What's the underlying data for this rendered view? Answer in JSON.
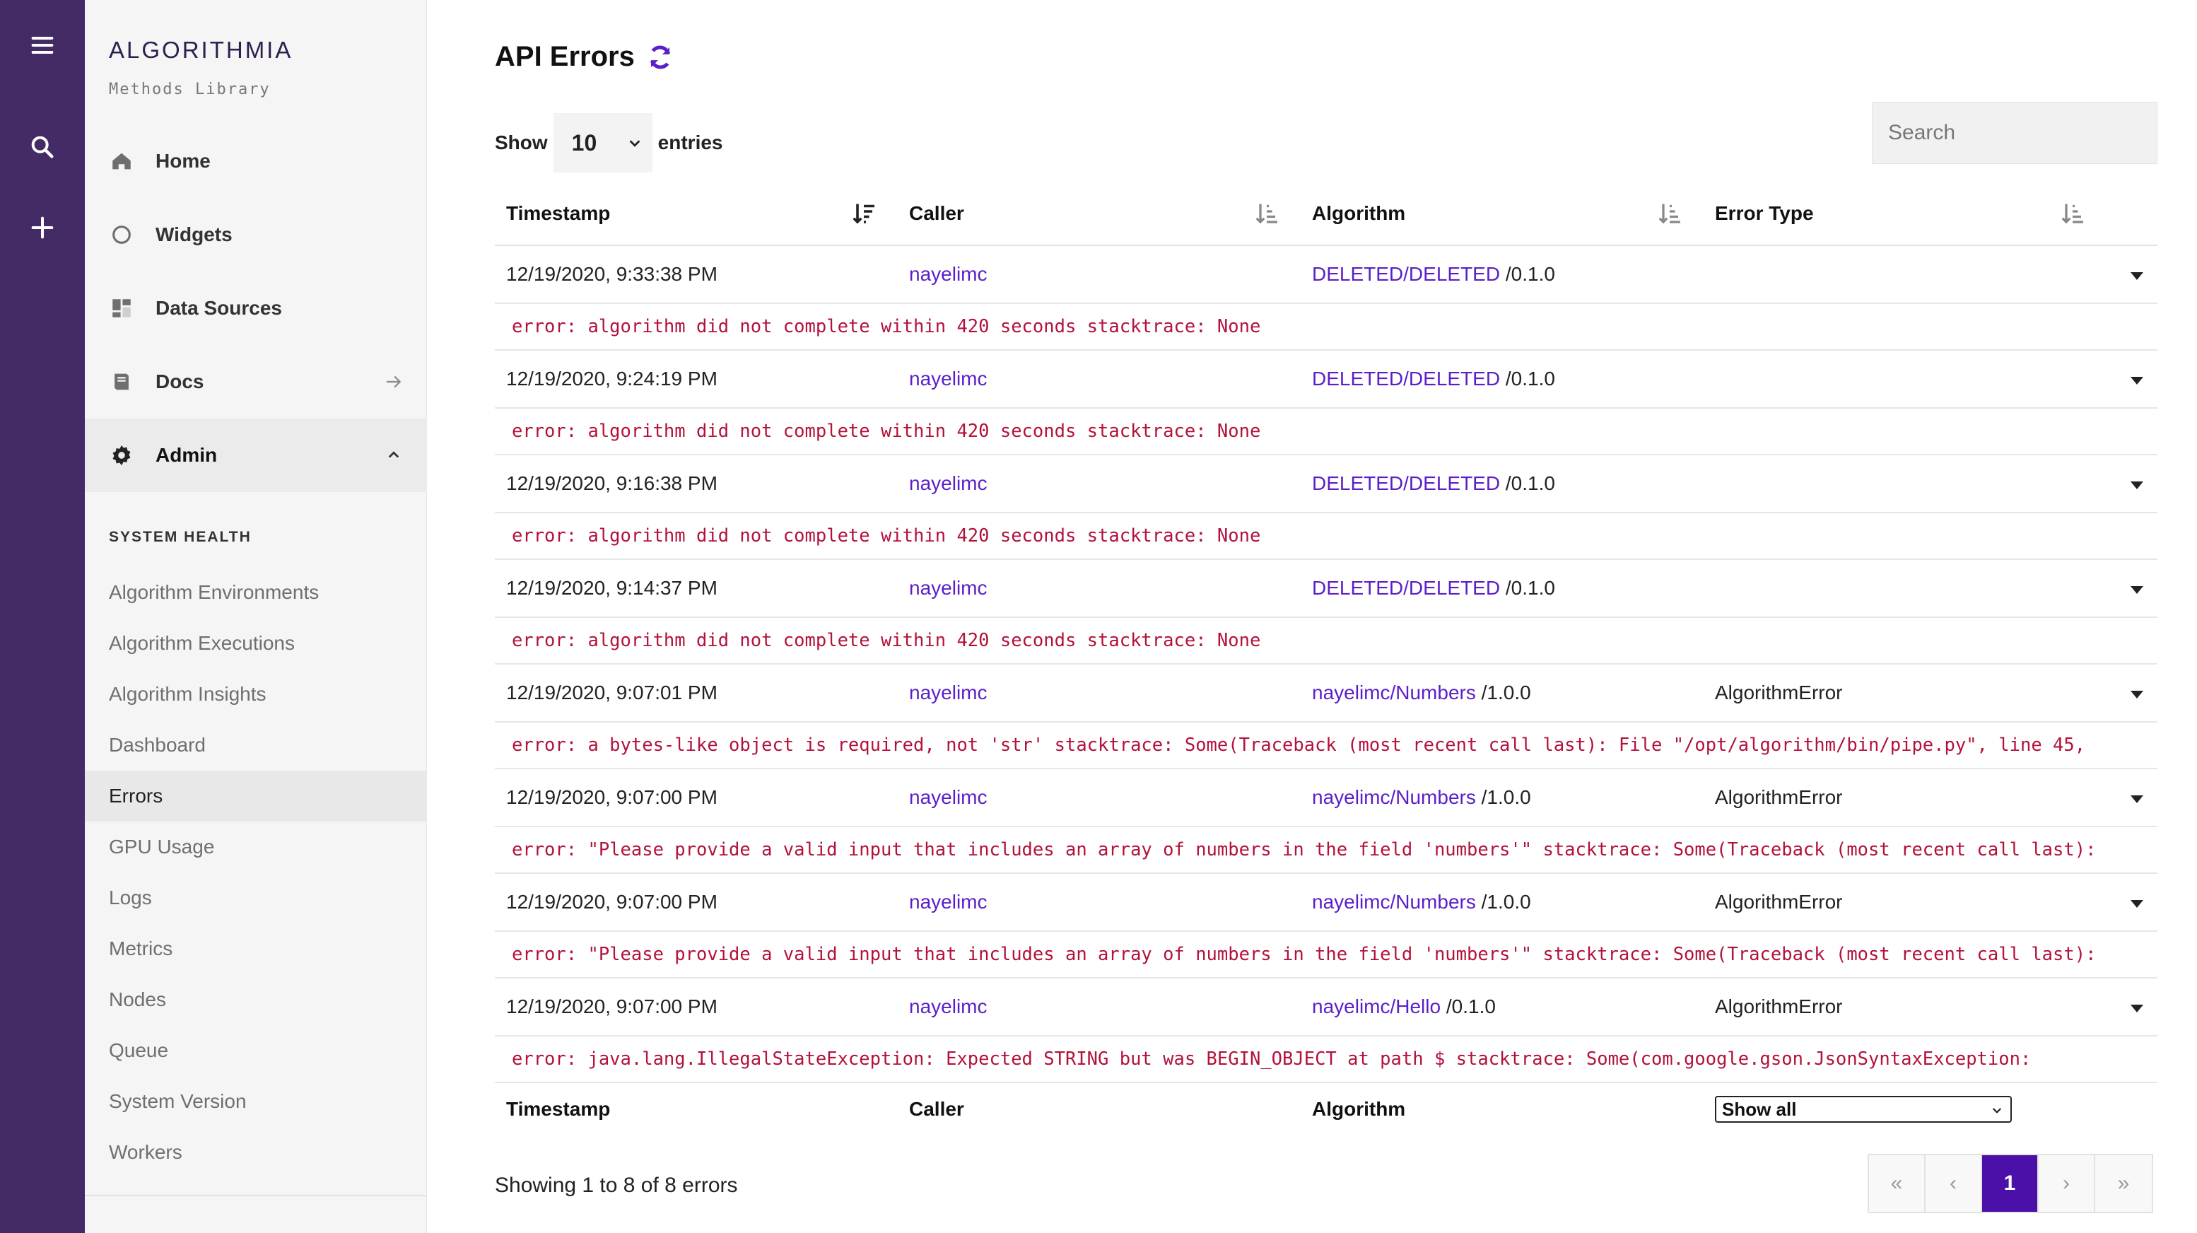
{
  "brand": {
    "name": "ALGORITHMIA",
    "subtitle": "Methods Library"
  },
  "nav": [
    {
      "label": "Home",
      "icon": "home-icon"
    },
    {
      "label": "Widgets",
      "icon": "circle-icon"
    },
    {
      "label": "Data Sources",
      "icon": "grid-icon"
    },
    {
      "label": "Docs",
      "icon": "book-icon"
    },
    {
      "label": "Admin",
      "icon": "gear-icon"
    }
  ],
  "admin_section": {
    "heading": "SYSTEM HEALTH",
    "items": [
      "Algorithm Environments",
      "Algorithm Executions",
      "Algorithm Insights",
      "Dashboard",
      "Errors",
      "GPU Usage",
      "Logs",
      "Metrics",
      "Nodes",
      "Queue",
      "System Version",
      "Workers"
    ],
    "selected": "Errors"
  },
  "page": {
    "title": "API Errors"
  },
  "controls": {
    "show_label": "Show",
    "entries_value": "10",
    "entries_label": "entries",
    "search_placeholder": "Search"
  },
  "table": {
    "columns": [
      "Timestamp",
      "Caller",
      "Algorithm",
      "Error Type"
    ],
    "footer_columns": [
      "Timestamp",
      "Caller",
      "Algorithm"
    ],
    "error_type_filter": "Show all",
    "rows": [
      {
        "timestamp": "12/19/2020, 9:33:38 PM",
        "caller": "nayelimc",
        "algorithm": "DELETED/DELETED",
        "version": "/0.1.0",
        "error_type": "",
        "message": "error: algorithm did not complete within 420 seconds stacktrace: None"
      },
      {
        "timestamp": "12/19/2020, 9:24:19 PM",
        "caller": "nayelimc",
        "algorithm": "DELETED/DELETED",
        "version": "/0.1.0",
        "error_type": "",
        "message": "error: algorithm did not complete within 420 seconds stacktrace: None"
      },
      {
        "timestamp": "12/19/2020, 9:16:38 PM",
        "caller": "nayelimc",
        "algorithm": "DELETED/DELETED",
        "version": "/0.1.0",
        "error_type": "",
        "message": "error: algorithm did not complete within 420 seconds stacktrace: None"
      },
      {
        "timestamp": "12/19/2020, 9:14:37 PM",
        "caller": "nayelimc",
        "algorithm": "DELETED/DELETED",
        "version": "/0.1.0",
        "error_type": "",
        "message": "error: algorithm did not complete within 420 seconds stacktrace: None"
      },
      {
        "timestamp": "12/19/2020, 9:07:01 PM",
        "caller": "nayelimc",
        "algorithm": "nayelimc/Numbers",
        "version": "/1.0.0",
        "error_type": "AlgorithmError",
        "message": "error: a bytes-like object is required, not 'str' stacktrace: Some(Traceback (most recent call last): File \"/opt/algorithm/bin/pipe.py\", line 45,"
      },
      {
        "timestamp": "12/19/2020, 9:07:00 PM",
        "caller": "nayelimc",
        "algorithm": "nayelimc/Numbers",
        "version": "/1.0.0",
        "error_type": "AlgorithmError",
        "message": "error: \"Please provide a valid input that includes an array of numbers in the field 'numbers'\" stacktrace: Some(Traceback (most recent call last):"
      },
      {
        "timestamp": "12/19/2020, 9:07:00 PM",
        "caller": "nayelimc",
        "algorithm": "nayelimc/Numbers",
        "version": "/1.0.0",
        "error_type": "AlgorithmError",
        "message": "error: \"Please provide a valid input that includes an array of numbers in the field 'numbers'\" stacktrace: Some(Traceback (most recent call last):"
      },
      {
        "timestamp": "12/19/2020, 9:07:00 PM",
        "caller": "nayelimc",
        "algorithm": "nayelimc/Hello",
        "version": "/0.1.0",
        "error_type": "AlgorithmError",
        "message": "error: java.lang.IllegalStateException: Expected STRING but was BEGIN_OBJECT at path $ stacktrace: Some(com.google.gson.JsonSyntaxException:"
      }
    ]
  },
  "summary": "Showing 1 to 8 of 8 errors",
  "pagination": {
    "first": "«",
    "prev": "‹",
    "current": "1",
    "next": "›",
    "last": "»"
  },
  "colors": {
    "rail": "#442b66",
    "link": "#5a1fc9",
    "error": "#b3123a",
    "page_active": "#4b10a8"
  }
}
